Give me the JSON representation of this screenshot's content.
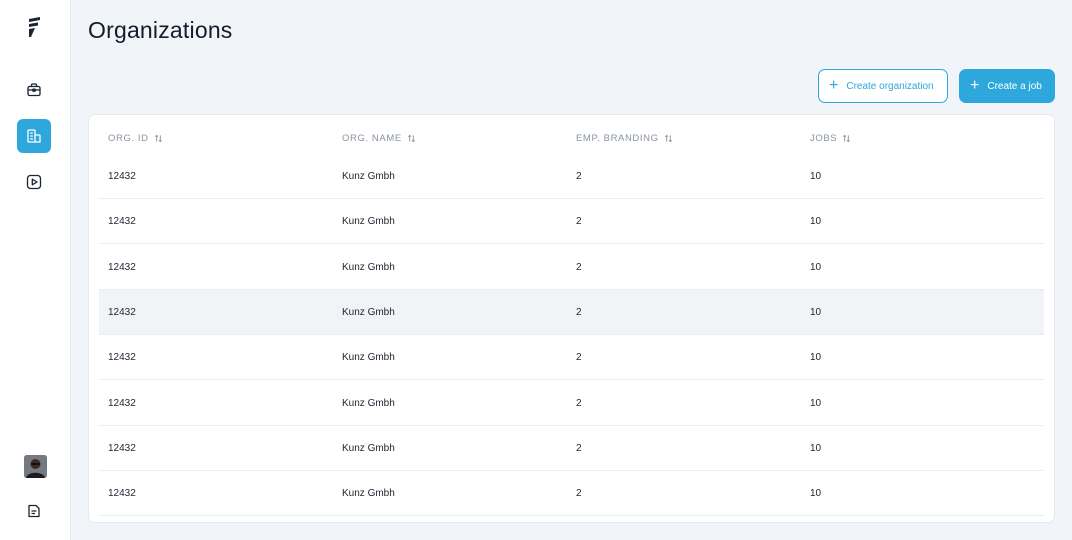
{
  "page": {
    "title": "Organizations"
  },
  "sidebar": {
    "logo": "logo-icon",
    "items": [
      {
        "icon": "briefcase-icon",
        "active": false
      },
      {
        "icon": "building-icon",
        "active": true
      },
      {
        "icon": "video-play-icon",
        "active": false
      }
    ],
    "bottom": [
      {
        "icon": "avatar"
      },
      {
        "icon": "document-icon"
      }
    ]
  },
  "toolbar": {
    "create_org_label": "Create organization",
    "create_job_label": "Create a job"
  },
  "table": {
    "headers": [
      "ORG. ID",
      "ORG. NAME",
      "EMP. BRANDING",
      "JOBS"
    ],
    "rows": [
      [
        "12432",
        "Kunz Gmbh",
        "2",
        "10"
      ],
      [
        "12432",
        "Kunz Gmbh",
        "2",
        "10"
      ],
      [
        "12432",
        "Kunz Gmbh",
        "2",
        "10"
      ],
      [
        "12432",
        "Kunz Gmbh",
        "2",
        "10"
      ],
      [
        "12432",
        "Kunz Gmbh",
        "2",
        "10"
      ],
      [
        "12432",
        "Kunz Gmbh",
        "2",
        "10"
      ],
      [
        "12432",
        "Kunz Gmbh",
        "2",
        "10"
      ],
      [
        "12432",
        "Kunz Gmbh",
        "2",
        "10"
      ]
    ],
    "highlighted_row": 3
  },
  "colors": {
    "accent": "#2ea8dc",
    "background": "#f1f4f8",
    "highlight_row": "#f1f4f7"
  }
}
